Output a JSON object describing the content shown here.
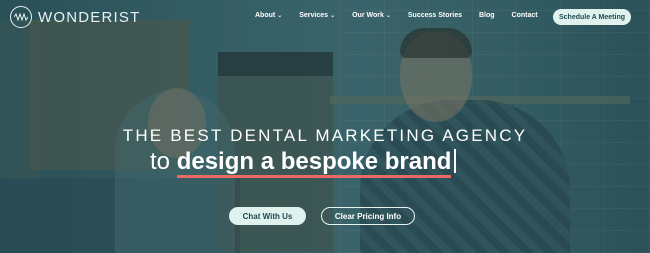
{
  "brand": {
    "logo_text": "WONDERIST",
    "logo_icon": "wave-circle-icon"
  },
  "nav": {
    "items": [
      {
        "label": "About",
        "has_dropdown": true
      },
      {
        "label": "Services",
        "has_dropdown": true
      },
      {
        "label": "Our Work",
        "has_dropdown": true
      },
      {
        "label": "Success Stories",
        "has_dropdown": false
      },
      {
        "label": "Blog",
        "has_dropdown": false
      },
      {
        "label": "Contact",
        "has_dropdown": false
      }
    ],
    "dropdown_icon": "chevron-down-icon",
    "cta_label": "Schedule A Meeting"
  },
  "hero": {
    "headline": "THE BEST DENTAL MARKETING AGENCY",
    "subline_prefix": "to",
    "subline_accent": "design a bespoke brand",
    "accent_color": "#e96a62",
    "primary_button": "Chat With Us",
    "secondary_button": "Clear Pricing Info"
  },
  "colors": {
    "overlay": "#3a6168",
    "button_fill": "#dff2ee",
    "button_text": "#1f4a52"
  }
}
